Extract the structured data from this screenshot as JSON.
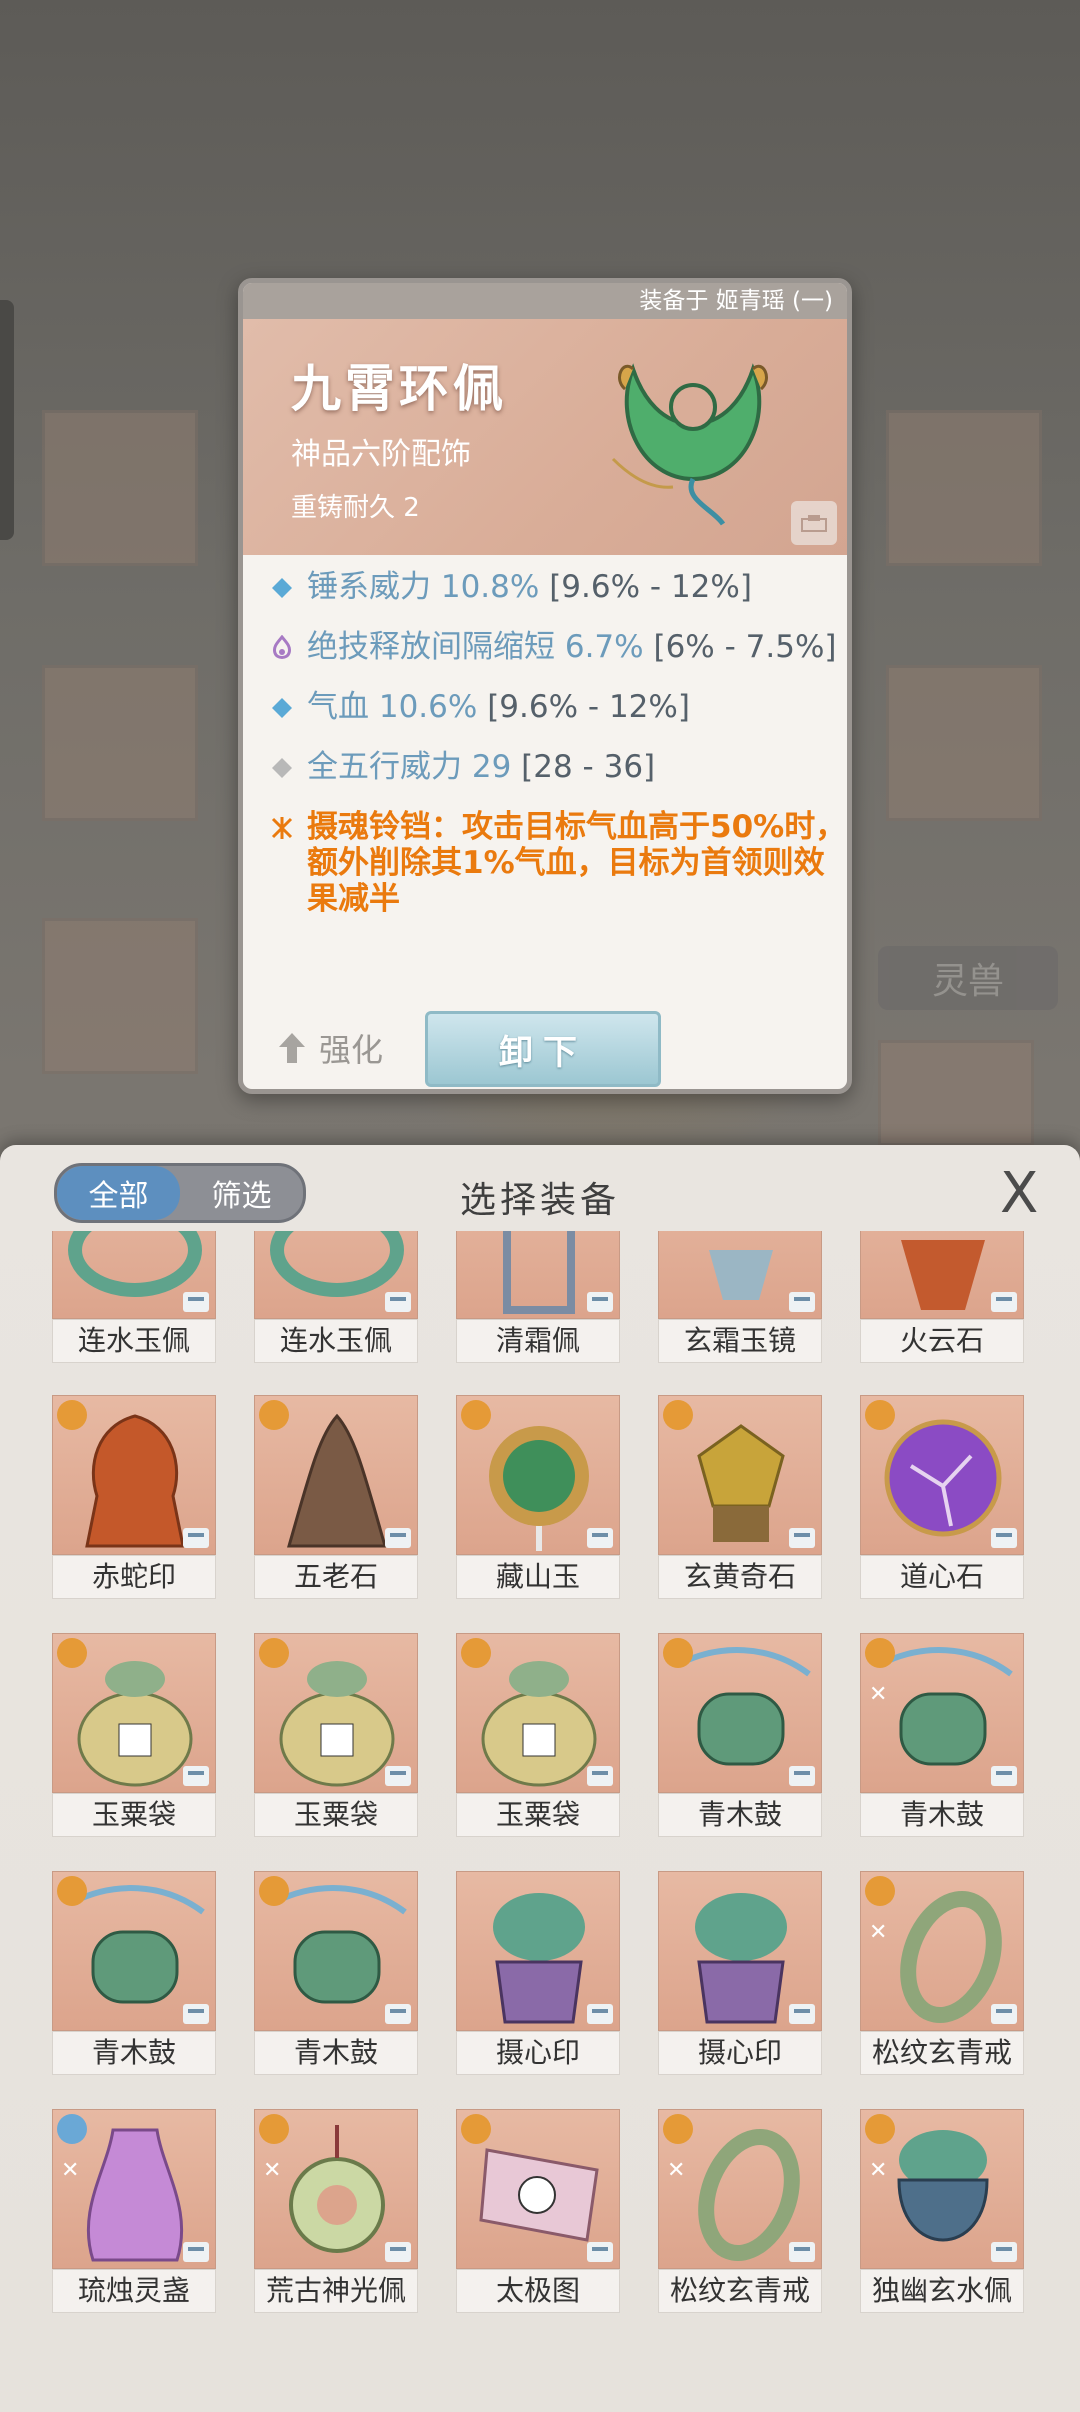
{
  "card": {
    "equipped_by": "装备于 姬青瑶 (一)",
    "name": "九霄环佩",
    "grade": "神品六阶配饰",
    "reforge": "重铸耐久 2",
    "stats": [
      {
        "name": "锤系威力 10.8%",
        "range": " [9.6% - 12%]",
        "icon": "blue-diamond-icon"
      },
      {
        "name": "绝技释放间隔缩短 6.7%",
        "range": " [6% - 7.5%]",
        "icon": "purple-flame-icon"
      },
      {
        "name": "气血 10.6%",
        "range": " [9.6% - 12%]",
        "icon": "blue-diamond-icon"
      },
      {
        "name": "全五行威力 29",
        "range": " [28 - 36]",
        "icon": "gray-diamond-icon"
      }
    ],
    "special": "摄魂铃铛：攻击目标气血高于50%时，额外削除其1%气血，目标为首领则效果减半",
    "upgrade_label": "强化",
    "unequip_label": "卸下"
  },
  "background": {
    "side_tab_label": "灵兽"
  },
  "panel": {
    "title": "选择装备",
    "filter_all": "全部",
    "filter_select": "筛选",
    "close": "X",
    "items": [
      {
        "label": "连水玉佩",
        "color": "#5fa38c"
      },
      {
        "label": "连水玉佩",
        "color": "#5fa38c"
      },
      {
        "label": "清霜佩",
        "color": "#7b8ca3"
      },
      {
        "label": "玄霜玉镜",
        "color": "#9bb6c4"
      },
      {
        "label": "火云石",
        "color": "#c35a2e"
      },
      {
        "label": "赤蛇印",
        "color": "#c4582a"
      },
      {
        "label": "五老石",
        "color": "#7a5a45"
      },
      {
        "label": "藏山玉",
        "color": "#3f8f5a"
      },
      {
        "label": "玄黄奇石",
        "color": "#c8a43a"
      },
      {
        "label": "道心石",
        "color": "#8b4bc4"
      },
      {
        "label": "玉粟袋",
        "color": "#b8b07a"
      },
      {
        "label": "玉粟袋",
        "color": "#b8b07a"
      },
      {
        "label": "玉粟袋",
        "color": "#b8b07a"
      },
      {
        "label": "青木鼓",
        "color": "#5f9a7a"
      },
      {
        "label": "青木鼓",
        "color": "#5f9a7a"
      },
      {
        "label": "青木鼓",
        "color": "#5f9a7a"
      },
      {
        "label": "青木鼓",
        "color": "#5f9a7a"
      },
      {
        "label": "摄心印",
        "color": "#8a6aa8"
      },
      {
        "label": "摄心印",
        "color": "#8a6aa8"
      },
      {
        "label": "松纹玄青戒",
        "color": "#8fa67a"
      },
      {
        "label": "琉烛灵盏",
        "color": "#c58ad6"
      },
      {
        "label": "荒古神光佩",
        "color": "#8fae7a"
      },
      {
        "label": "太极图",
        "color": "#d6a6c0"
      },
      {
        "label": "松纹玄青戒",
        "color": "#8fa67a"
      },
      {
        "label": "独幽玄水佩",
        "color": "#4e6f8a"
      }
    ]
  }
}
